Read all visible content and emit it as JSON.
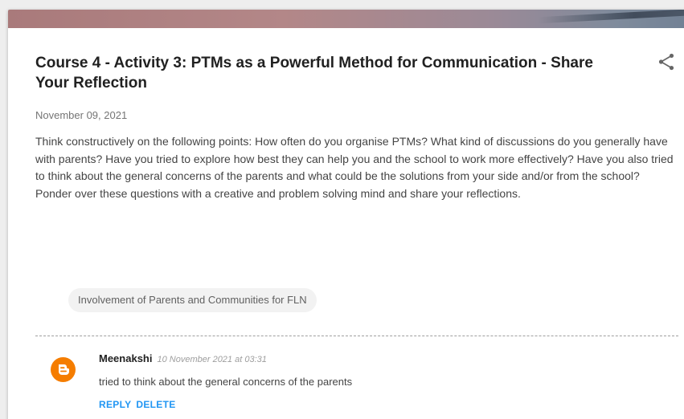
{
  "post": {
    "title": "Course 4 - Activity 3: PTMs as a Powerful Method for Communication - Share Your Reflection",
    "date": "November 09, 2021",
    "body": "Think constructively on the following points: How often do you organise PTMs? What kind of discussions do you generally have with parents? Have you tried to explore how best they can help you and the school to work more effectively? Have you also tried to think about the general concerns of the parents and what could be the solutions from your side and/or from the school? Ponder over these questions with a creative and problem solving mind and share your reflections.",
    "label": "Involvement of Parents and Communities for FLN",
    "share_icon": "share-icon"
  },
  "comment": {
    "author": "Meenakshi",
    "timestamp": "10 November 2021 at 03:31",
    "text": "tried to think about the general concerns of the parents",
    "reply_label": "REPLY",
    "delete_label": "DELETE",
    "avatar_icon": "blogger-icon"
  },
  "colors": {
    "accent": "#2196f3",
    "avatar": "#f57d00",
    "title": "#212121",
    "body": "#444444"
  }
}
